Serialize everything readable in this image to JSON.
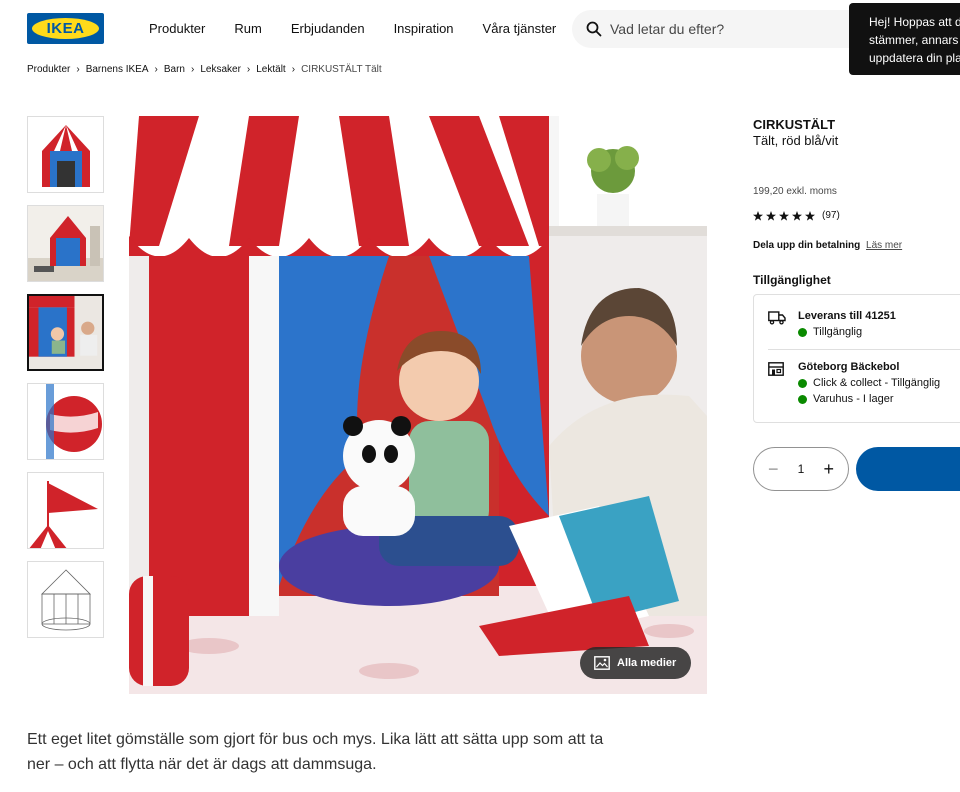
{
  "brand": {
    "logo_text": "IKEA",
    "blue": "#0058a3",
    "yellow": "#ffda1a"
  },
  "nav": {
    "items": [
      "Produkter",
      "Rum",
      "Erbjudanden",
      "Inspiration",
      "Våra tjänster"
    ]
  },
  "search": {
    "placeholder": "Vad letar du efter?",
    "icon": "search-icon"
  },
  "tooltip": {
    "lines": [
      "Hej! Hoppas att d",
      "stämmer, annars",
      "uppdatera din pla"
    ]
  },
  "breadcrumb": {
    "items": [
      "Produkter",
      "Barnens IKEA",
      "Barn",
      "Leksaker",
      "Lektält"
    ],
    "current": "CIRKUSTÄLT Tält"
  },
  "gallery": {
    "thumbnail_count": 6,
    "active_index": 2,
    "all_media_label": "Alla medier"
  },
  "product": {
    "name": "CIRKUSTÄLT",
    "description": "Tält, röd blå/vit",
    "price": "199,20 exkl. moms",
    "rating": 5,
    "rating_count": "(97)",
    "installment_label": "Dela upp din betalning",
    "installment_link": "Läs mer"
  },
  "availability": {
    "title": "Tillgänglighet",
    "delivery": {
      "title": "Leverans till 41251",
      "status": "Tillgänglig",
      "icon": "truck-icon"
    },
    "store": {
      "title": "Göteborg Bäckebol",
      "lines": [
        "Click & collect - Tillgänglig",
        "Varuhus - I lager"
      ],
      "icon": "store-icon"
    },
    "status_color": "#0a8a00"
  },
  "quantity": {
    "value": "1",
    "minus": "−",
    "plus": "+"
  },
  "long_description": "Ett eget litet gömställe som gjort för bus och mys. Lika lätt att sätta upp som att ta ner – och att flytta när det är dags att dammsuga."
}
